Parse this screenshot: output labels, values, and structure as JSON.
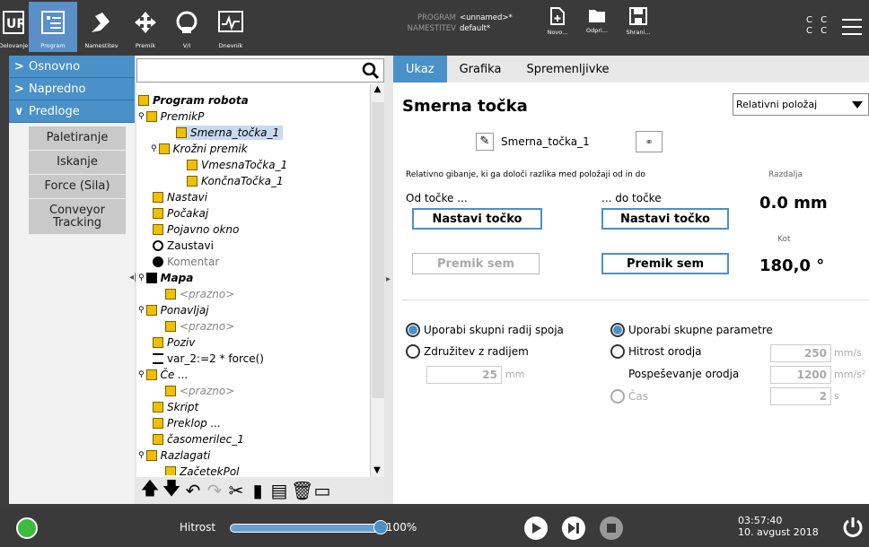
{
  "topnav": {
    "items": [
      {
        "label": "Delovanje",
        "icon": "ur-logo-icon"
      },
      {
        "label": "Program",
        "icon": "program-icon"
      },
      {
        "label": "Namestitev",
        "icon": "installation-icon"
      },
      {
        "label": "Premik",
        "icon": "move-icon"
      },
      {
        "label": "V/I",
        "icon": "io-icon"
      },
      {
        "label": "Dnevnik",
        "icon": "log-icon"
      }
    ],
    "program_key": "PROGRAM",
    "program_val": "<unnamed>*",
    "install_key": "NAMESTITEV",
    "install_val": "default*",
    "new": "Novo...",
    "open": "Odpri...",
    "save": "Shrani...",
    "cc1": "C C",
    "cc2": "C C"
  },
  "sidebar": {
    "categories": [
      "Osnovno",
      "Napredno",
      "Predloge"
    ],
    "items": [
      "Paletiranje",
      "Iskanje",
      "Force (Sila)",
      "Conveyor Tracking"
    ]
  },
  "tree": {
    "search": "",
    "nodes": [
      "Program robota",
      "PremikP",
      "Smerna_točka_1",
      "Krožni premik",
      "VmesnaTočka_1",
      "KončnaTočka_1",
      "Nastavi",
      "Počakaj",
      "Pojavno okno",
      "Zaustavi",
      "Komentar",
      "Mapa",
      "<prazno>",
      "Ponavljaj",
      "<prazno>",
      "Poziv",
      "var_2:=2 * force()",
      "Če ...",
      "<prazno>",
      "Skript",
      "Preklop ...",
      "časomerilec_1",
      "Razlagati",
      "ZačetekPol"
    ]
  },
  "panel": {
    "tabs": [
      "Ukaz",
      "Grafika",
      "Spremenljivke"
    ],
    "title": "Smerna točka",
    "mode": "Relativni položaj",
    "name": "Smerna_točka_1",
    "desc": "Relativno gibanje, ki ga določi razlika med položaji od in do",
    "from": "Od točke ...",
    "to": "... do točke",
    "set_from": "Nastavi točko",
    "set_to": "Nastavi točko",
    "move_from": "Premik sem",
    "move_to": "Premik sem",
    "dist_label": "Razdalja",
    "dist": "0.0 mm",
    "angle_label": "Kot",
    "angle": "180,0 °",
    "r_shared_radius": "Uporabi skupni radij spoja",
    "r_blend": "Združitev z radijem",
    "blend_val": "25",
    "blend_unit": "mm",
    "r_shared_params": "Uporabi skupne parametre",
    "r_tool_speed": "Hitrost orodja",
    "tool_speed_val": "250",
    "tool_speed_unit": "mm/s",
    "tool_acc_label": "Pospeševanje orodja",
    "tool_acc_val": "1200",
    "tool_acc_unit": "mm/s²",
    "r_time": "Čas",
    "time_val": "2",
    "time_unit": "s"
  },
  "bottom": {
    "speed_label": "Hitrost",
    "speed": "100%",
    "speed_fraction": 1.0,
    "time": "03:57:40",
    "date": "10. avgust 2018"
  }
}
